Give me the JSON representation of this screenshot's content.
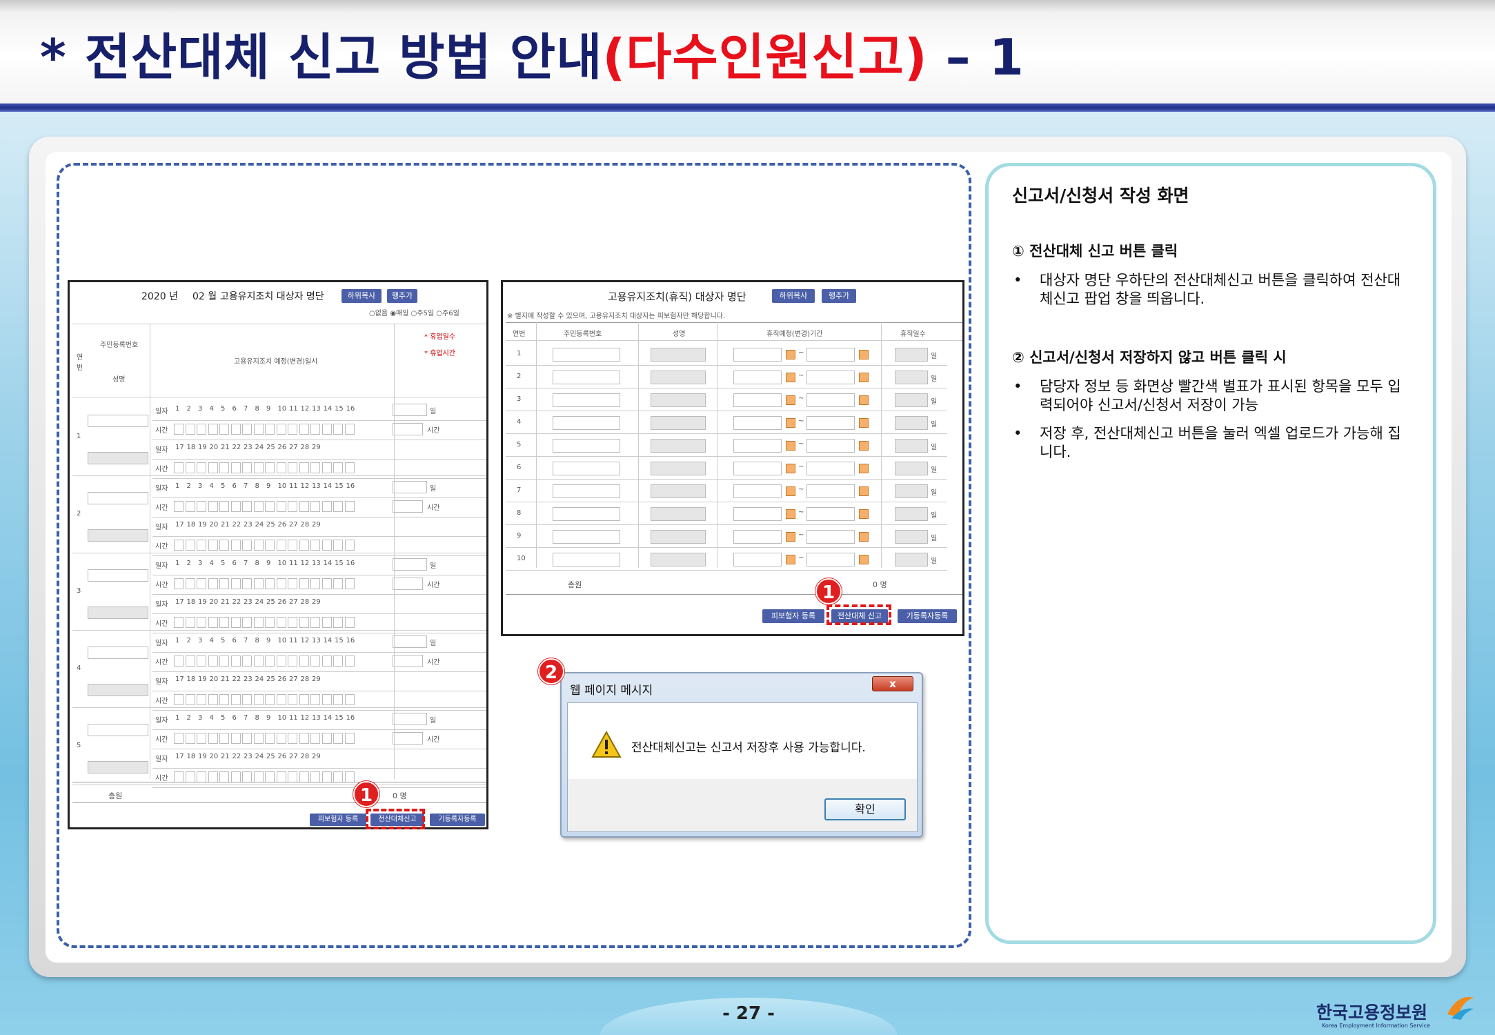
{
  "header": {
    "bullet": "*",
    "title_main": "전산대체 신고 방법 안내",
    "title_accent": "(다수인원신고)",
    "title_suffix": " – 1"
  },
  "screen1": {
    "year": "2020 년",
    "month": "02 월",
    "title": "고용유지조치 대상자 명단",
    "buttons": [
      "하위목사",
      "행추가"
    ],
    "radios": [
      "없음",
      "매일",
      "주5일",
      "주6일"
    ],
    "col_reg": "주민등록번호",
    "col_name": "성명",
    "col_no": "연번",
    "col_plan": "고용유지조치 예정(변경)일시",
    "col_days": "휴업일수",
    "col_hours": "휴업시간",
    "row_day": "일자",
    "row_time": "시간",
    "unit_day": "일",
    "unit_hour": "시간",
    "days_a": [
      "1",
      "2",
      "3",
      "4",
      "5",
      "6",
      "7",
      "8",
      "9",
      "10",
      "11",
      "12",
      "13",
      "14",
      "15",
      "16"
    ],
    "days_b": [
      "17",
      "18",
      "19",
      "20",
      "21",
      "22",
      "23",
      "24",
      "25",
      "26",
      "27",
      "28",
      "29"
    ],
    "rows": [
      "1",
      "2",
      "3",
      "4",
      "5"
    ],
    "total_label": "총원",
    "total_value": "0 명",
    "bottom_buttons": [
      "피보험자 등록",
      "전산대체신고",
      "기등록자등록"
    ]
  },
  "screen2": {
    "title": "고용유지조치(휴직) 대상자 명단",
    "buttons": [
      "하위복사",
      "행추가"
    ],
    "note": "※ 별지에 작성할 수 있으며, 고용유지조치 대상자는 피보험자만 해당합니다.",
    "cols": [
      "연번",
      "주민등록번호",
      "성명",
      "휴직예정(변경)기간",
      "휴직일수"
    ],
    "rows": [
      "1",
      "2",
      "3",
      "4",
      "5",
      "6",
      "7",
      "8",
      "9",
      "10"
    ],
    "unit": "일",
    "tilde": "~",
    "total_label": "총원",
    "total_value": "0 명",
    "bottom_buttons": [
      "피보험자 등록",
      "전산대체 신고",
      "기등록자등록"
    ]
  },
  "dialog": {
    "title": "웹 페이지 메시지",
    "message": "전산대체신고는 신고서 저장후 사용 가능합니다.",
    "ok": "확인",
    "close": "x"
  },
  "badges": {
    "one": "1",
    "two": "2"
  },
  "right_panel": {
    "title": "신고서/신청서 작성 화면",
    "sec1": "① 전산대체 신고 버튼 클릭",
    "sec1_bullets": [
      "대상자 명단 우하단의 전산대체신고 버튼을 클릭하여 전산대체신고 팝업 창을 띄웁니다."
    ],
    "sec2": "② 신고서/신청서 저장하지 않고 버튼 클릭 시",
    "sec2_bullets": [
      "담당자 정보 등 화면상 빨간색 별표가 표시된 항목을 모두 입력되어야 신고서/신청서 저장이 가능",
      "저장 후, 전산대체신고 버튼을 눌러 엑셀 업로드가 가능해 집니다."
    ]
  },
  "footer": {
    "page": "- 27 -",
    "logo_kr": "한국고용정보원",
    "logo_en": "Korea Employment Information Service"
  },
  "colors": {
    "title_navy": "#17206b",
    "title_red": "#e8101b",
    "badge_red": "#e02020",
    "button_blue": "#4b5fa8"
  }
}
